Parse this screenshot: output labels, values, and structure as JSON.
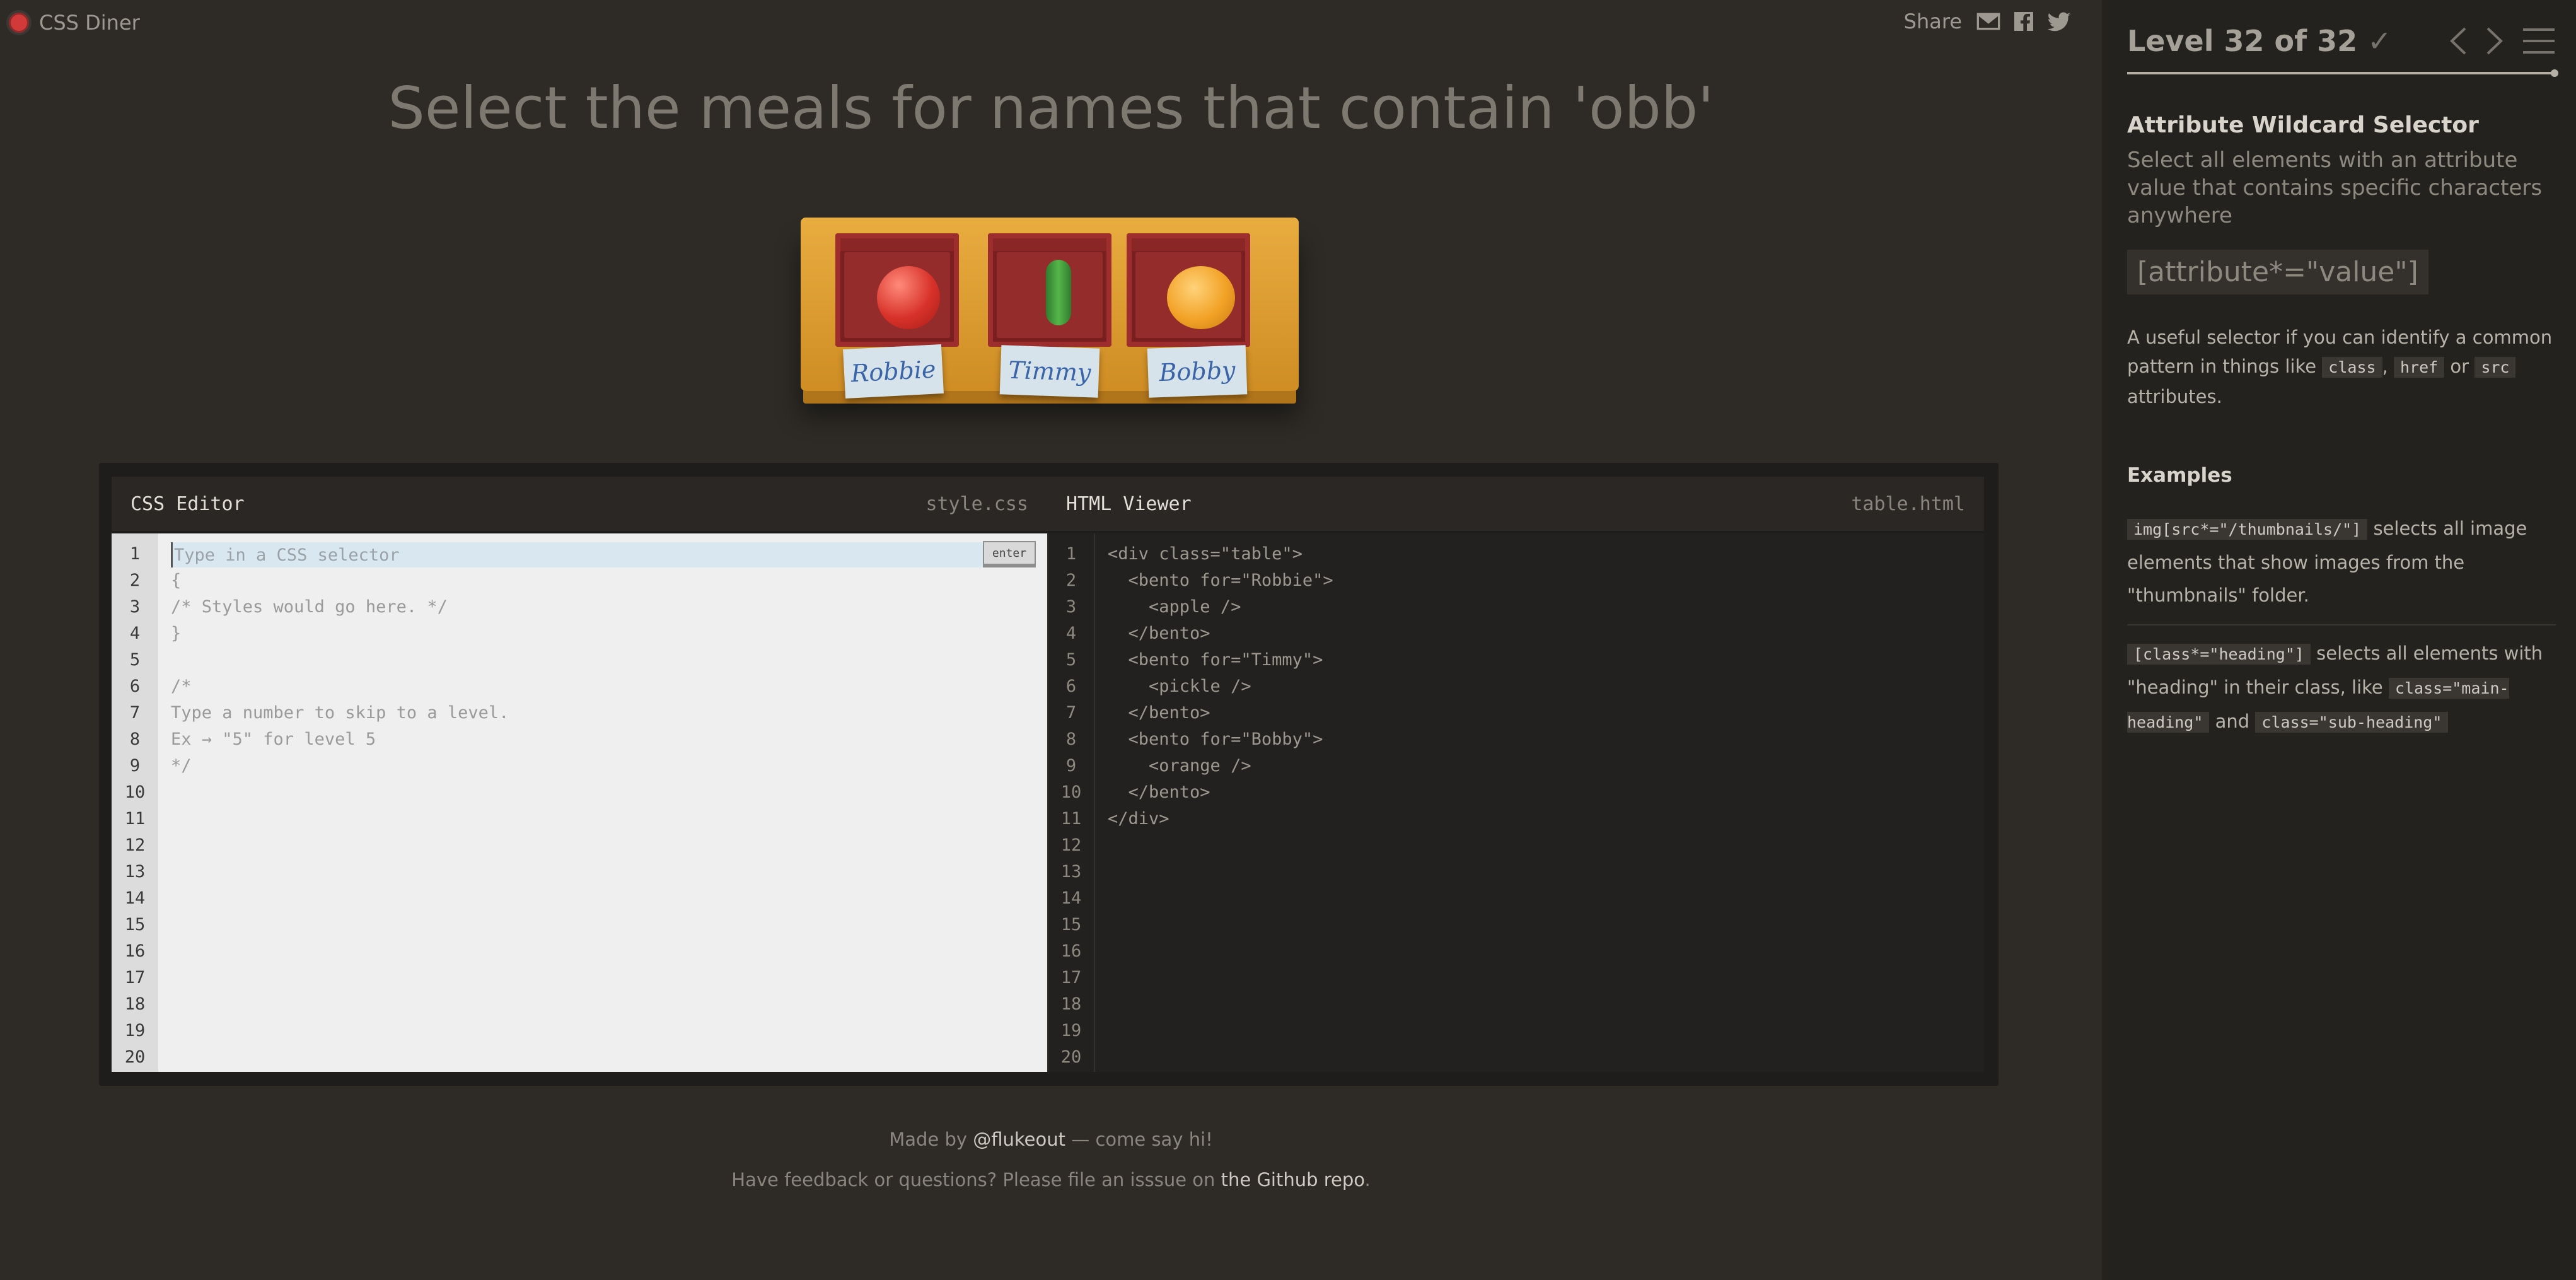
{
  "app": {
    "brand": "CSS Diner"
  },
  "share": {
    "label": "Share",
    "icons": [
      "mail-icon",
      "facebook-icon",
      "twitter-icon"
    ]
  },
  "order": {
    "text": "Select the meals for names that contain 'obb'"
  },
  "table": {
    "bentos": [
      {
        "name": "Robbie",
        "food": "apple"
      },
      {
        "name": "Timmy",
        "food": "pickle"
      },
      {
        "name": "Bobby",
        "food": "orange"
      }
    ]
  },
  "editor": {
    "css": {
      "title": "CSS Editor",
      "file": "style.css",
      "placeholder": "Type in a CSS selector",
      "enter_label": "enter",
      "lines": [
        "",
        "{",
        "/* Styles would go here. */",
        "}",
        "",
        "/*",
        "Type a number to skip to a level.",
        "Ex → \"5\" for level 5",
        "*/"
      ],
      "line_numbers": [
        "1",
        "2",
        "3",
        "4",
        "5",
        "6",
        "7",
        "8",
        "9",
        "10",
        "11",
        "12",
        "13",
        "14",
        "15",
        "16",
        "17",
        "18",
        "19",
        "20"
      ]
    },
    "html": {
      "title": "HTML Viewer",
      "file": "table.html",
      "lines": [
        "<div class=\"table\">",
        "  <bento for=\"Robbie\">",
        "    <apple />",
        "  </bento>",
        "  <bento for=\"Timmy\">",
        "    <pickle />",
        "  </bento>",
        "  <bento for=\"Bobby\">",
        "    <orange />",
        "  </bento>",
        "</div>"
      ],
      "line_numbers": [
        "1",
        "2",
        "3",
        "4",
        "5",
        "6",
        "7",
        "8",
        "9",
        "10",
        "11",
        "12",
        "13",
        "14",
        "15",
        "16",
        "17",
        "18",
        "19",
        "20"
      ]
    }
  },
  "footer": {
    "made_by_prefix": "Made by ",
    "made_by_link": "@flukeout",
    "made_by_suffix": " — come say hi!",
    "feedback_prefix": "Have feedback or questions? Please file an isssue on ",
    "feedback_link": "the Github repo",
    "feedback_suffix": "."
  },
  "sidebar": {
    "level_title": "Level 32 of 32",
    "level_check": "✓",
    "progress": 1.0,
    "selector_name": "Attribute Wildcard Selector",
    "syntax_desc": "Select all elements with an attribute value that contains specific characters anywhere",
    "syntax": "[attribute*=\"value\"]",
    "hint": {
      "text1": "A useful selector if you can identify a common pattern in things like ",
      "chip1": "class",
      "sep1": ", ",
      "chip2": "href",
      "sep2": " or ",
      "chip3": "src",
      "text2": " attributes."
    },
    "examples_title": "Examples",
    "examples": [
      {
        "code": "img[src*=\"/thumbnails/\"]",
        "text": " selects all image elements that show images from the \"thumbnails\" folder."
      },
      {
        "code": "[class*=\"heading\"]",
        "text": " selects all elements with \"heading\" in their class, like ",
        "code2": "class=\"main-heading\"",
        "mid": " and ",
        "code3": "class=\"sub-heading\""
      }
    ]
  }
}
